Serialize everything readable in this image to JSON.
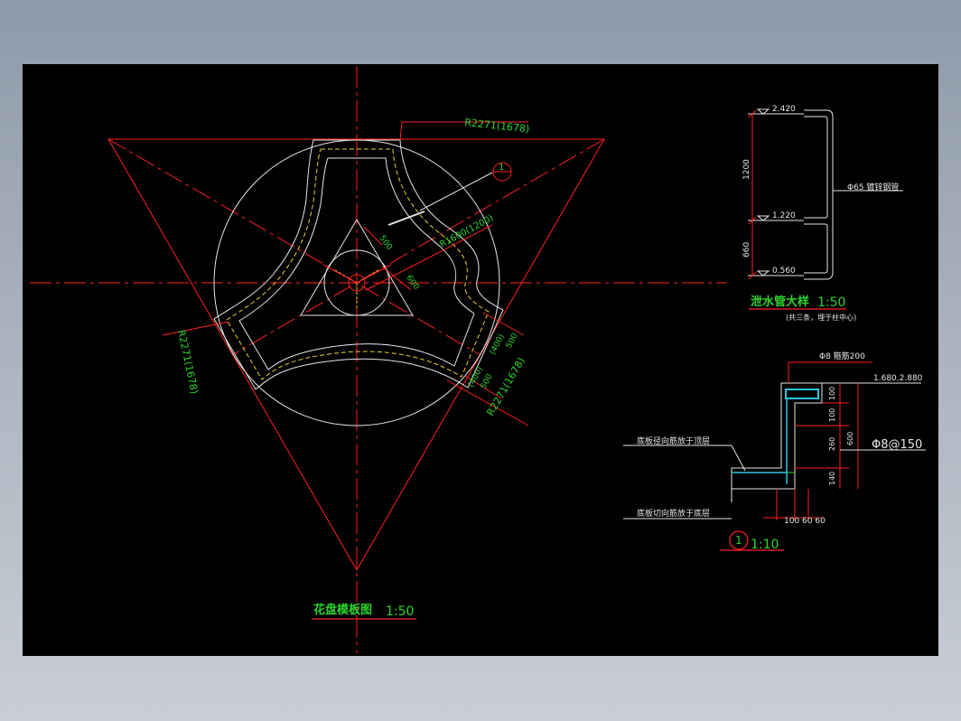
{
  "plan": {
    "title": "花盘模板图",
    "scale": "1:50",
    "radius_outer_top": "R2271(1678)",
    "radius_outer_left": "R2271(1678)",
    "radius_outer_right": "R2271(1678)",
    "radius_inner": "R1600(1200)",
    "dim_500_a": "500",
    "dim_600": "600",
    "dim_400_500": "(400)\n500",
    "dim_400_b": "(400)",
    "dim_500_b": "500",
    "dim_400_c": "(400)",
    "dim_500_c": "500",
    "callout": "1"
  },
  "pipe_detail": {
    "title": "泄水管大样",
    "scale": "1:50",
    "note": "(共三条，埋于柱中心)",
    "elev_top": "2.420",
    "elev_mid": "1.220",
    "elev_bot": "0.560",
    "dim_1200": "1200",
    "dim_660": "660",
    "pipe_label": "Φ65 镀锌钢管"
  },
  "section": {
    "callout": "1",
    "scale": "1:10",
    "rebar_top": "Φ8 箍筋200",
    "elev": "1.680,2.880",
    "rebar_right": "Φ8@150",
    "label_top": "底板径向筋放于顶层",
    "label_bottom": "底板切向筋放于底层",
    "dim_100a": "100",
    "dim_100b": "100",
    "dim_260": "260",
    "dim_140": "140",
    "dim_600": "600",
    "dims_bottom": "100 60 60"
  },
  "colors": {
    "background": "#000000",
    "frame": "#8e9aaa",
    "red_lines": "#ff2020",
    "white_lines": "#e6e6e6",
    "green_text": "#2bd42b",
    "yellow_dash": "#e8d22a"
  }
}
